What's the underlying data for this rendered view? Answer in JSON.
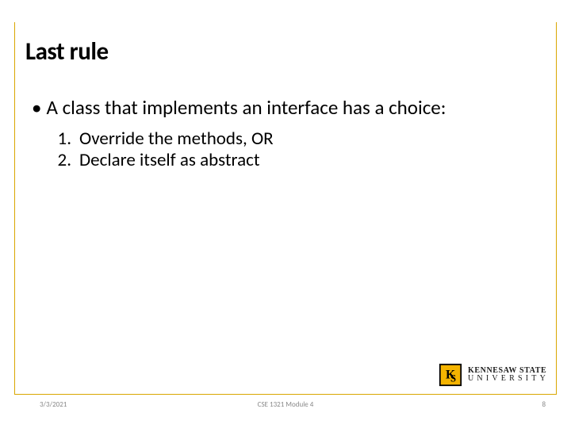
{
  "title": "Last rule",
  "bullet": "A class that implements an interface has a choice:",
  "numbered": [
    "Override the methods, OR",
    "Declare itself as abstract"
  ],
  "footer": {
    "date": "3/3/2021",
    "center": "CSE 1321 Module 4",
    "pageno": "8"
  },
  "logo": {
    "line1": "KENNESAW STATE",
    "line2": "UNIVERSITY"
  }
}
